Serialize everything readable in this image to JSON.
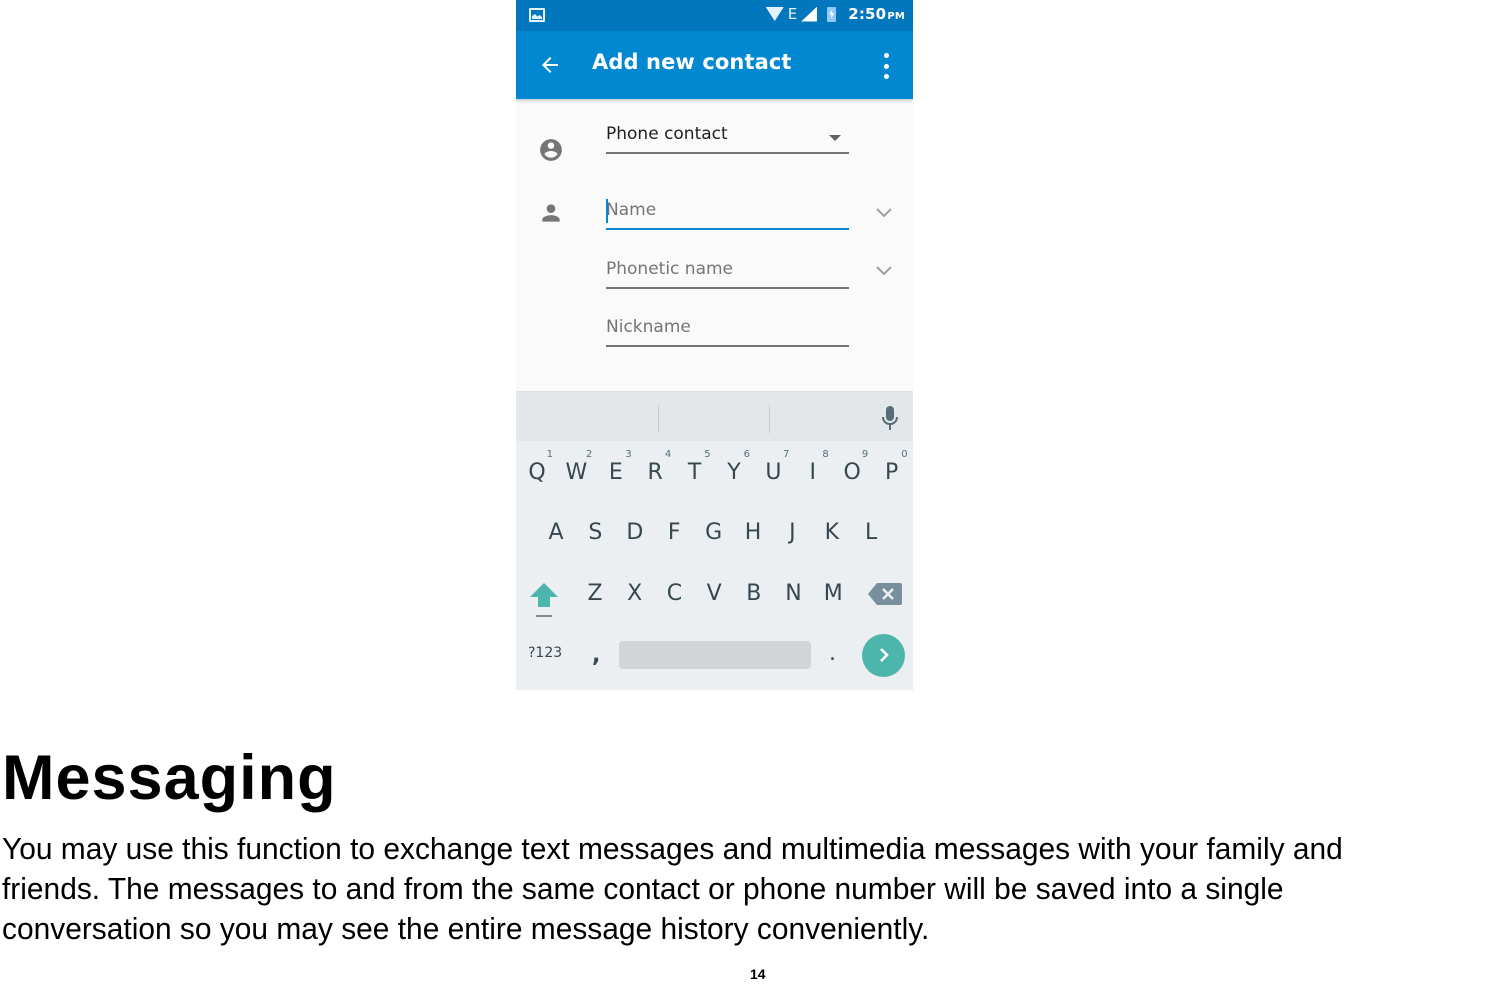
{
  "phone": {
    "status_bar": {
      "left_icon": "image-notification-icon",
      "network_type": "E",
      "time": "2:50",
      "ampm": "PM",
      "icons": [
        "wifi-icon",
        "signal-icon",
        "battery-charging-icon"
      ]
    },
    "app_bar": {
      "title": "Add new contact",
      "back_icon": "arrow-back-icon",
      "menu_icon": "more-vert-icon",
      "color": "#0288d1",
      "status_color": "#0277bd"
    },
    "form": {
      "account_selector": {
        "value": "Phone contact",
        "icon": "account-circle-icon"
      },
      "fields": [
        {
          "placeholder": "Name",
          "icon": "person-icon",
          "active": true,
          "expandable": true
        },
        {
          "placeholder": "Phonetic name",
          "expandable": true
        },
        {
          "placeholder": "Nickname",
          "expandable": false
        }
      ]
    },
    "keyboard": {
      "row1": [
        {
          "key": "Q",
          "hint": "1"
        },
        {
          "key": "W",
          "hint": "2"
        },
        {
          "key": "E",
          "hint": "3"
        },
        {
          "key": "R",
          "hint": "4"
        },
        {
          "key": "T",
          "hint": "5"
        },
        {
          "key": "Y",
          "hint": "6"
        },
        {
          "key": "U",
          "hint": "7"
        },
        {
          "key": "I",
          "hint": "8"
        },
        {
          "key": "O",
          "hint": "9"
        },
        {
          "key": "P",
          "hint": "0"
        }
      ],
      "row2": [
        "A",
        "S",
        "D",
        "F",
        "G",
        "H",
        "J",
        "K",
        "L"
      ],
      "row3": [
        "Z",
        "X",
        "C",
        "V",
        "B",
        "N",
        "M"
      ],
      "symbols_label": "?123",
      "comma": ",",
      "period": ".",
      "accent_color": "#4db6ac"
    }
  },
  "document": {
    "heading": "Messaging",
    "body_lines": [
      "You may use this function to exchange text messages and multimedia messages with your family and",
      "friends. The messages to and from the same contact or phone number will be saved into a single",
      "conversation so you may see the entire message history conveniently."
    ],
    "page_number": "14"
  }
}
